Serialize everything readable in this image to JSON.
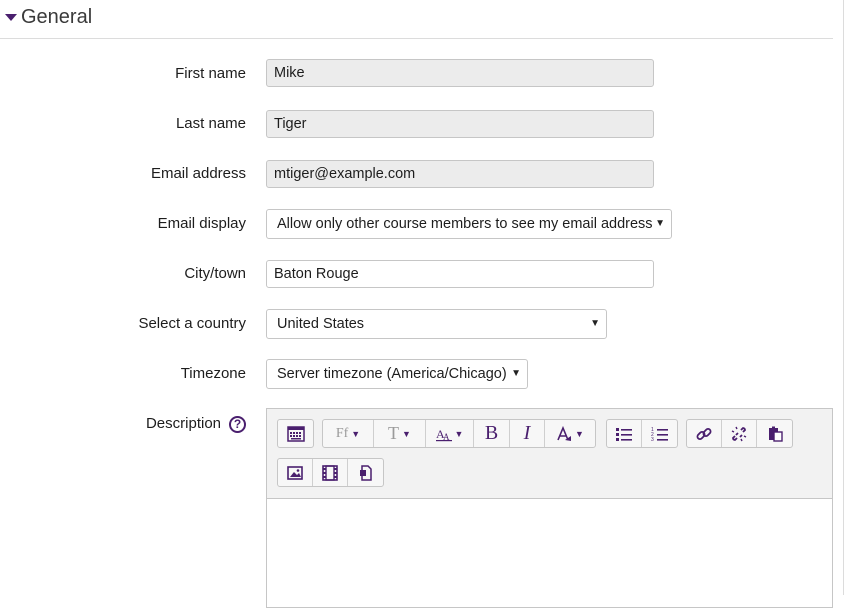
{
  "section": {
    "title": "General"
  },
  "fields": {
    "first_name": {
      "label": "First name",
      "value": "Mike"
    },
    "last_name": {
      "label": "Last name",
      "value": "Tiger"
    },
    "email": {
      "label": "Email address",
      "value": "mtiger@example.com"
    },
    "email_display": {
      "label": "Email display",
      "value": "Allow only other course members to see my email address"
    },
    "city": {
      "label": "City/town",
      "value": "Baton Rouge"
    },
    "country": {
      "label": "Select a country",
      "value": "United States"
    },
    "timezone": {
      "label": "Timezone",
      "value": "Server timezone (America/Chicago)"
    },
    "description": {
      "label": "Description"
    }
  },
  "editor_toolbar": {
    "font_family_label": "Ff",
    "font_size_label": "T",
    "bold_label": "B",
    "italic_label": "I"
  },
  "colors": {
    "accent": "#4a1f6e",
    "readonly_bg": "#ececec",
    "border": "#c6c6c6"
  }
}
